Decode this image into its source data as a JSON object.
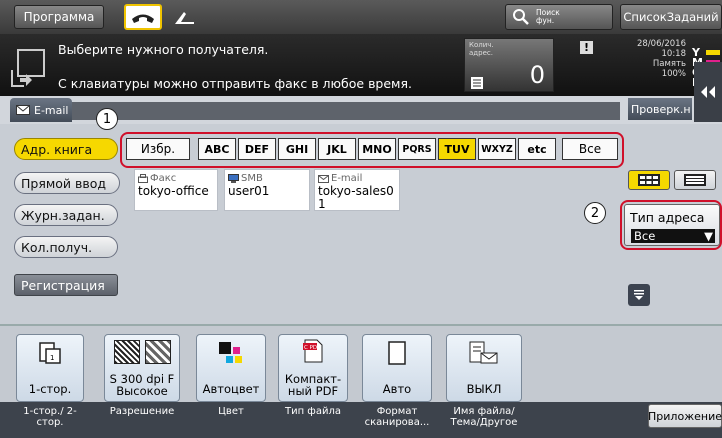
{
  "topbar": {
    "program_label": "Программа",
    "search_label": "Поиск фун.",
    "joblist_label": "СписокЗаданий"
  },
  "message": {
    "line1": "Выберите нужного получателя.",
    "line2": "С клавиатуры можно отправить факс в любое время.",
    "count_label": "Колич. адрес.",
    "count_value": "0",
    "date": "28/06/2016",
    "time": "10:18",
    "memory_label": "Память",
    "memory_value": "100%",
    "toner_letters": [
      "Y",
      "M",
      "C",
      "K"
    ]
  },
  "tabs": {
    "email_label": "E-mail",
    "check_label": "Проверк.н"
  },
  "sidebar": {
    "items": [
      {
        "label": "Адр. книга",
        "active": true
      },
      {
        "label": "Прямой ввод",
        "active": false
      },
      {
        "label": "Журн.задан.",
        "active": false
      },
      {
        "label": "Кол.получ.",
        "active": false
      }
    ],
    "register_label": "Регистрация"
  },
  "index": {
    "tabs": [
      "Избр.",
      "ABC",
      "DEF",
      "GHI",
      "JKL",
      "MNO",
      "PQRS",
      "TUV",
      "WXYZ",
      "etc",
      "Все"
    ],
    "selected": "TUV"
  },
  "destinations": [
    {
      "type": "Факс",
      "name": "tokyo-office"
    },
    {
      "type": "SMB",
      "name": "user01"
    },
    {
      "type": "E-mail",
      "name": "tokyo-sales01"
    }
  ],
  "address_type": {
    "label": "Тип адреса",
    "value": "Все"
  },
  "callouts": [
    "1",
    "2"
  ],
  "functions": [
    {
      "value": "1-стор.",
      "label": "1-стор./ 2-стор."
    },
    {
      "value": "S 300 dpi F Высокое",
      "label": "Разрешение"
    },
    {
      "value": "Автоцвет",
      "label": "Цвет"
    },
    {
      "value": "Компакт- ный PDF",
      "label": "Тип файла"
    },
    {
      "value": "Авто",
      "label": "Формат сканирова..."
    },
    {
      "value": "ВЫКЛ",
      "label": "Имя файла/ Тема/Другое"
    }
  ],
  "app_label": "Приложение",
  "colors": {
    "accent_yellow": "#f5d800",
    "callout_red": "#d0102a",
    "dark_panel": "#1a1a1a"
  }
}
